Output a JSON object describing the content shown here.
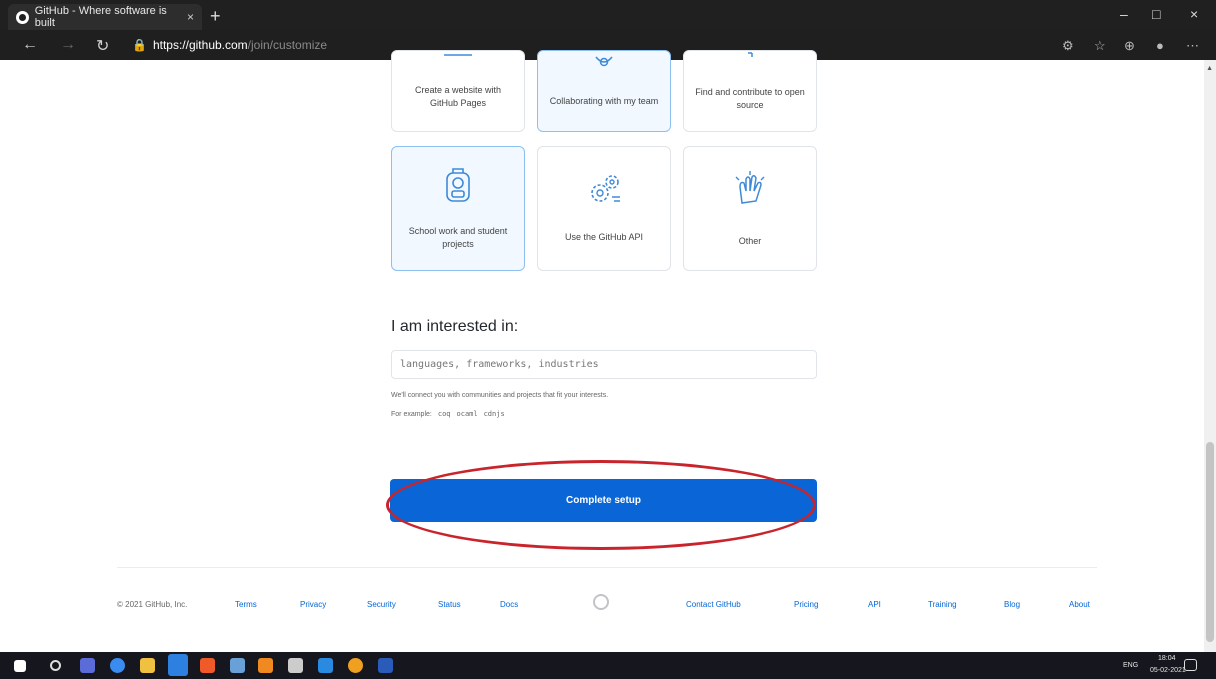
{
  "browser": {
    "tab_title": "GitHub - Where software is built",
    "tab_close": "×",
    "new_tab": "+",
    "url_host": "https://github.com",
    "url_path": "/join/customize",
    "win_min": "–",
    "win_max": "□",
    "win_close": "×"
  },
  "cards": {
    "row1": [
      {
        "label": "Create a website with GitHub Pages",
        "selected": false
      },
      {
        "label": "Collaborating with my team",
        "selected": true
      },
      {
        "label": "Find and contribute to open source",
        "selected": false
      }
    ],
    "row2": [
      {
        "label": "School work and student projects",
        "selected": true
      },
      {
        "label": "Use the GitHub API",
        "selected": false
      },
      {
        "label": "Other",
        "selected": false
      }
    ]
  },
  "interests": {
    "title": "I am interested in:",
    "placeholder": "languages, frameworks, industries",
    "hint": "We'll connect you with communities and projects that fit your interests.",
    "example_label": "For example:",
    "examples": [
      "coq",
      "ocaml",
      "cdnjs"
    ]
  },
  "complete_button": "Complete setup",
  "footer": {
    "copyright": "© 2021 GitHub, Inc.",
    "left_links": [
      "Terms",
      "Privacy",
      "Security",
      "Status",
      "Docs"
    ],
    "right_links": [
      "Contact GitHub",
      "Pricing",
      "API",
      "Training",
      "Blog",
      "About"
    ]
  },
  "taskbar": {
    "lang": "ENG",
    "time": "18:04",
    "date": "05-02-2021"
  }
}
